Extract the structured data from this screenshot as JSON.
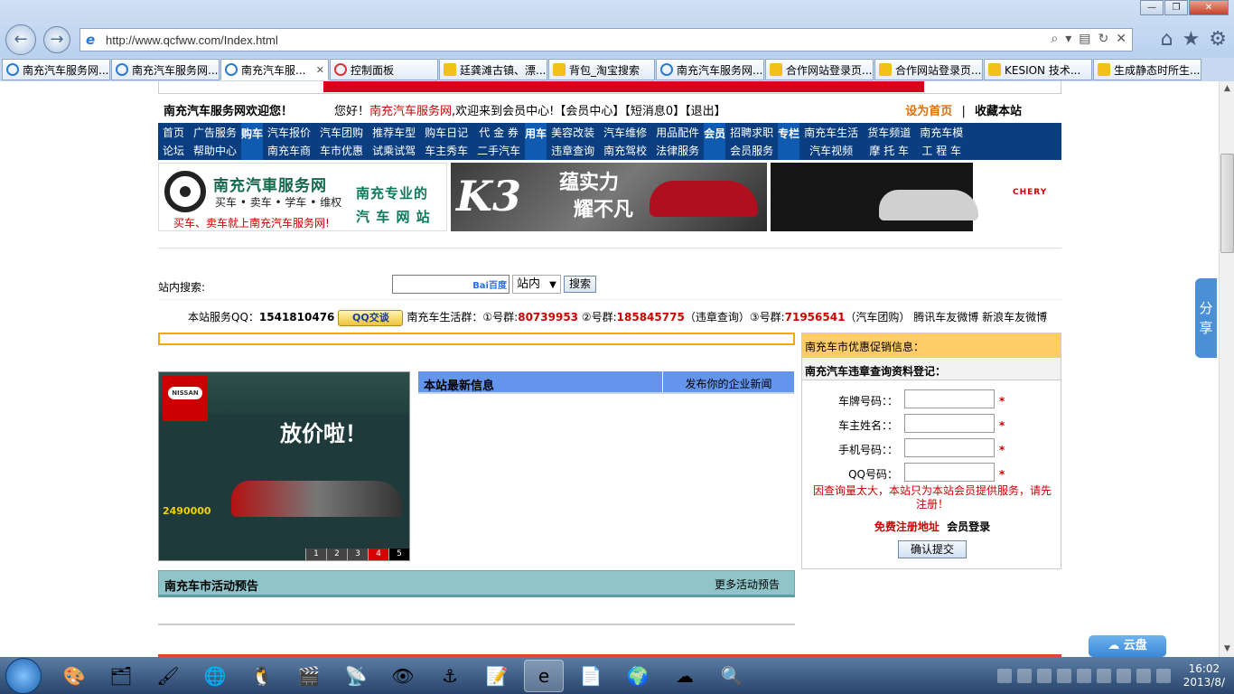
{
  "browser": {
    "window_controls": [
      "—",
      "❐",
      "✕"
    ],
    "url": "http://www.qcfww.com/Index.html",
    "tabs": [
      {
        "title": "南充汽车服务网...",
        "icon": "ie",
        "active": false
      },
      {
        "title": "南充汽车服务网...",
        "icon": "ie",
        "active": false
      },
      {
        "title": "南充汽车服...",
        "icon": "ie",
        "active": true,
        "close": "✕"
      },
      {
        "title": "控制面板",
        "icon": "red",
        "active": false
      },
      {
        "title": "廷龚滩古镇、漂...",
        "icon": "yellow",
        "active": false
      },
      {
        "title": "背包_淘宝搜索",
        "icon": "yellow",
        "active": false
      },
      {
        "title": "南充汽车服务网...",
        "icon": "ie",
        "active": false
      },
      {
        "title": "合作网站登录页...",
        "icon": "yellow",
        "active": false
      },
      {
        "title": "合作网站登录页...",
        "icon": "yellow",
        "active": false
      },
      {
        "title": "KESION 技术...",
        "icon": "yellow",
        "active": false
      },
      {
        "title": "生成静态时所生...",
        "icon": "yellow",
        "active": false
      }
    ]
  },
  "header": {
    "site_welcome": "南充汽车服务网欢迎您！",
    "greeting_prefix": "您好！",
    "greeting_site": "南充汽车服务网",
    "greeting_suffix": ",欢迎来到会员中心!【会员中心】【短消息0】【退出】",
    "set_home": "设为首页",
    "separator": "|",
    "bookmark": "收藏本站"
  },
  "nav": {
    "g1": [
      "首页",
      "论坛",
      "广告服务",
      "帮助中心"
    ],
    "cat1": "购车",
    "g2": [
      "汽车报价",
      "南充车商",
      "汽车团购",
      "车市优惠",
      "推荐车型",
      "试乘试驾",
      "购车日记",
      "车主秀车",
      "代 金 券",
      "二手汽车"
    ],
    "cat2": "用车",
    "g3": [
      "美容改装",
      "违章查询",
      "汽车维修",
      "南充驾校",
      "用品配件",
      "法律服务"
    ],
    "cat3": "会员",
    "g4": [
      "招聘求职",
      "会员服务"
    ],
    "cat4": "专栏",
    "g5": [
      "南充车生活",
      "汽车视频",
      "货车频道",
      "摩 托 车",
      "南充车模",
      "工 程 车"
    ]
  },
  "banners": {
    "logo_title": "南充汽車服务网",
    "logo_sub": "买车 • 卖车 • 学车 • 维权",
    "logo_slogan": "买车、卖车就上南充汽车服务网!",
    "logo_right_1": "南充专业的",
    "logo_right_2": "汽 车 网 站",
    "k3_model": "K3",
    "k3_slogan_1": "蕴实力",
    "k3_slogan_2": "耀不凡",
    "chery_logo": "CHERY"
  },
  "search": {
    "label": "站内搜索:",
    "input_value": "",
    "engine_mark": "Bai百度",
    "scope": "站内",
    "button": "搜索"
  },
  "qq": {
    "prefix": "本站服务QQ：",
    "qq_number": "1541810476",
    "qq_button": "QQ交谈",
    "group_prefix": "南充车生活群：①号群:",
    "group1": "80739953",
    "group2_prefix": "②号群:",
    "group2": "185845775",
    "group2_note": "（违章查询）③号群:",
    "group3": "71956541",
    "group3_note": "（汽车团购）",
    "weibo": "腾讯车友微博  新浪车友微博"
  },
  "slider": {
    "brand": "NISSAN",
    "headline": "放价啦！",
    "price": "2490000",
    "pages": [
      "1",
      "2",
      "3",
      "4",
      "5"
    ],
    "active_page": "4"
  },
  "news": {
    "title": "本站最新信息",
    "publish_link": "发布你的企业新闻"
  },
  "events": {
    "title": "南充车市活动预告",
    "more": "更多活动预告"
  },
  "sidebar": {
    "promo": "南充车市优惠促销信息：",
    "reg_title": "南充汽车违章查询资料登记：",
    "fields": [
      {
        "label": "车牌号码：：",
        "value": ""
      },
      {
        "label": "车主姓名：：",
        "value": ""
      },
      {
        "label": "手机号码：：",
        "value": ""
      },
      {
        "label": "QQ号码：",
        "value": ""
      }
    ],
    "required_mark": "*",
    "notice": "因查询量太大，本站只为本站会员提供服务，请先注册！",
    "register_link": "免费注册地址",
    "login_link": "会员登录",
    "submit": "确认提交"
  },
  "floating": {
    "share": "分享",
    "cloud": "云盘"
  },
  "taskbar": {
    "time": "16:02",
    "date": "2013/8/"
  }
}
